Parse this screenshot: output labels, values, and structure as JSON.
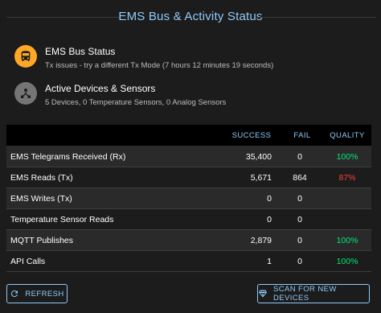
{
  "header": {
    "title": "EMS Bus & Activity Status"
  },
  "status": [
    {
      "icon": "bus-icon",
      "color": "#ffa726",
      "title": "EMS Bus Status",
      "subtitle": "Tx issues - try a different Tx Mode (7 hours 12 minutes 19 seconds)"
    },
    {
      "icon": "device-hub-icon",
      "color": "#757575",
      "title": "Active Devices & Sensors",
      "subtitle": "5 Devices, 0 Temperature Sensors, 0 Analog Sensors"
    }
  ],
  "table": {
    "columns": {
      "success": "SUCCESS",
      "fail": "FAIL",
      "quality": "QUALITY"
    },
    "rows": [
      {
        "label": "EMS Telegrams Received (Rx)",
        "success": "35,400",
        "fail": "0",
        "quality": "100%",
        "quality_status": "good"
      },
      {
        "label": "EMS Reads (Tx)",
        "success": "5,671",
        "fail": "864",
        "quality": "87%",
        "quality_status": "bad"
      },
      {
        "label": "EMS Writes (Tx)",
        "success": "0",
        "fail": "0",
        "quality": "",
        "quality_status": ""
      },
      {
        "label": "Temperature Sensor Reads",
        "success": "0",
        "fail": "0",
        "quality": "",
        "quality_status": ""
      },
      {
        "label": "MQTT Publishes",
        "success": "2,879",
        "fail": "0",
        "quality": "100%",
        "quality_status": "good"
      },
      {
        "label": "API Calls",
        "success": "1",
        "fail": "0",
        "quality": "100%",
        "quality_status": "good"
      }
    ]
  },
  "buttons": {
    "refresh": "REFRESH",
    "scan": "SCAN FOR NEW DEVICES"
  },
  "colors": {
    "accent": "#90caf9",
    "good": "#00e676",
    "bad": "#f44336",
    "warning": "#ffa726"
  }
}
